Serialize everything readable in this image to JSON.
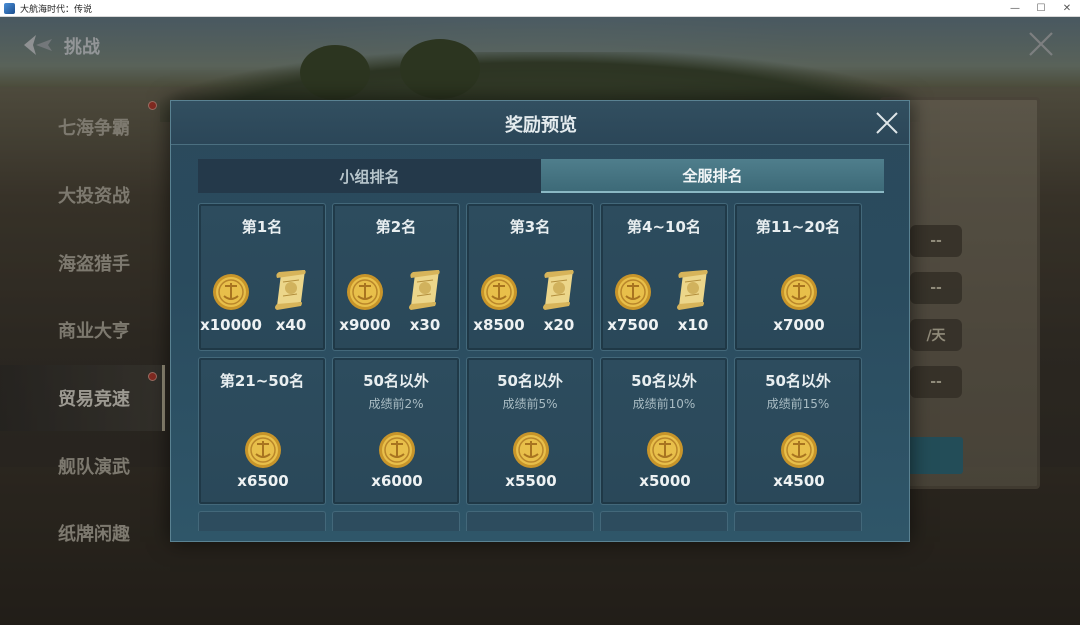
{
  "window": {
    "title": "大航海时代：传说",
    "min": "—",
    "max": "☐",
    "close": "✕"
  },
  "header": {
    "title": "挑战"
  },
  "sidenav": {
    "items": [
      {
        "label": "七海争霸",
        "dot": true
      },
      {
        "label": "大投资战",
        "dot": false
      },
      {
        "label": "海盗猎手",
        "dot": false
      },
      {
        "label": "商业大亨",
        "dot": false
      },
      {
        "label": "贸易竞速",
        "dot": true,
        "active": true
      },
      {
        "label": "舰队演武",
        "dot": false
      },
      {
        "label": "纸牌闲趣",
        "dot": false
      }
    ]
  },
  "background_panel": {
    "slots": [
      "--",
      "--",
      "/天",
      "--"
    ]
  },
  "modal": {
    "title": "奖励预览",
    "tabs": [
      {
        "label": "小组排名",
        "active": false
      },
      {
        "label": "全服排名",
        "active": true
      }
    ],
    "cards": [
      {
        "title": "第1名",
        "sub": "",
        "rewards": [
          {
            "icon": "gold-coin-icon",
            "qty": "x10000"
          },
          {
            "icon": "scroll-icon",
            "qty": "x40"
          }
        ]
      },
      {
        "title": "第2名",
        "sub": "",
        "rewards": [
          {
            "icon": "gold-coin-icon",
            "qty": "x9000"
          },
          {
            "icon": "scroll-icon",
            "qty": "x30"
          }
        ]
      },
      {
        "title": "第3名",
        "sub": "",
        "rewards": [
          {
            "icon": "gold-coin-icon",
            "qty": "x8500"
          },
          {
            "icon": "scroll-icon",
            "qty": "x20"
          }
        ]
      },
      {
        "title": "第4~10名",
        "sub": "",
        "rewards": [
          {
            "icon": "gold-coin-icon",
            "qty": "x7500"
          },
          {
            "icon": "scroll-icon",
            "qty": "x10"
          }
        ]
      },
      {
        "title": "第11~20名",
        "sub": "",
        "rewards": [
          {
            "icon": "gold-coin-icon",
            "qty": "x7000"
          }
        ]
      },
      {
        "title": "第21~50名",
        "sub": "",
        "rewards": [
          {
            "icon": "gold-coin-icon",
            "qty": "x6500"
          }
        ]
      },
      {
        "title": "50名以外",
        "sub": "成绩前2%",
        "rewards": [
          {
            "icon": "gold-coin-icon",
            "qty": "x6000"
          }
        ]
      },
      {
        "title": "50名以外",
        "sub": "成绩前5%",
        "rewards": [
          {
            "icon": "gold-coin-icon",
            "qty": "x5500"
          }
        ]
      },
      {
        "title": "50名以外",
        "sub": "成绩前10%",
        "rewards": [
          {
            "icon": "gold-coin-icon",
            "qty": "x5000"
          }
        ]
      },
      {
        "title": "50名以外",
        "sub": "成绩前15%",
        "rewards": [
          {
            "icon": "gold-coin-icon",
            "qty": "x4500"
          }
        ]
      }
    ]
  },
  "colors": {
    "accent": "#3d6a78",
    "modal_bg": "#2a4b5e",
    "gold": "#e2b43a",
    "alert_dot": "#c0392b"
  }
}
